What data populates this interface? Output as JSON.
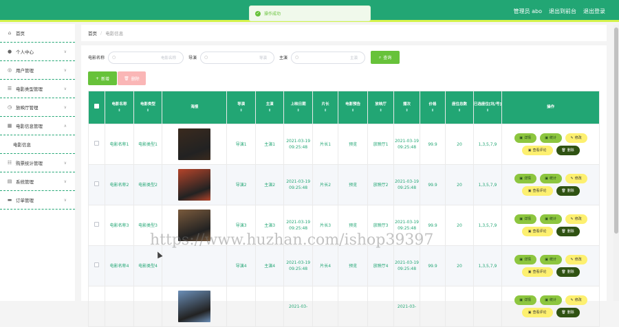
{
  "header": {
    "user": "管理员 abo",
    "back_label": "退出到前台",
    "logout_label": "退出登录"
  },
  "toast": {
    "message": "操作成功"
  },
  "sidebar": {
    "items": [
      {
        "label": "首页",
        "icon": "home-icon",
        "chev": ""
      },
      {
        "label": "个人中心",
        "icon": "user-icon",
        "chev": "∨"
      },
      {
        "label": "用户管理",
        "icon": "users-icon",
        "chev": "∨"
      },
      {
        "label": "电影类型管理",
        "icon": "list-icon",
        "chev": "∨"
      },
      {
        "label": "放映厅管理",
        "icon": "clock-icon",
        "chev": "∨"
      },
      {
        "label": "电影信息管理",
        "icon": "grid-icon",
        "chev": "∧"
      },
      {
        "label": "电影信息",
        "sub": true
      },
      {
        "label": "购票统计管理",
        "icon": "chart-icon",
        "chev": "∨"
      },
      {
        "label": "系统管理",
        "icon": "settings-icon",
        "chev": "∨"
      },
      {
        "label": "订单管理",
        "icon": "order-icon",
        "chev": "∨"
      }
    ]
  },
  "breadcrumb": {
    "home": "首页",
    "sep": "/",
    "current": "电影信息"
  },
  "search": {
    "label1": "电影名称",
    "ph1": "电影名称",
    "label2": "导演",
    "ph2": "导演",
    "label3": "主演",
    "ph3": "主演",
    "button": "查询"
  },
  "actions": {
    "add": "新增",
    "delete": "删除"
  },
  "table": {
    "headers": [
      "电影名称",
      "电影类型",
      "海报",
      "导演",
      "主演",
      "上映日期",
      "片长",
      "电影预告",
      "放映厅",
      "播次",
      "价格",
      "座位总数",
      "已选座位[坑/号]",
      "操作"
    ],
    "rows": [
      {
        "name": "电影名称1",
        "type": "电影类型1",
        "director": "导演1",
        "actor": "主演1",
        "date": "2021-03-19 09:25:48",
        "length": "片长1",
        "trailer": "预览",
        "hall": "放映厅1",
        "show": "2021-03-19 09:25:48",
        "price": "99.9",
        "seats": "20",
        "selected": "1,3,5,7,9",
        "poster": "#3a2a1e"
      },
      {
        "name": "电影名称2",
        "type": "电影类型2",
        "director": "导演2",
        "actor": "主演2",
        "date": "2021-03-19 09:25:48",
        "length": "片长2",
        "trailer": "预览",
        "hall": "放映厅2",
        "show": "2021-03-19 09:25:48",
        "price": "99.9",
        "seats": "20",
        "selected": "1,3,5,7,9",
        "poster": "#b5442a"
      },
      {
        "name": "电影名称3",
        "type": "电影类型3",
        "director": "导演3",
        "actor": "主演3",
        "date": "2021-03-19 09:25:48",
        "length": "片长3",
        "trailer": "预览",
        "hall": "放映厅3",
        "show": "2021-03-19 09:25:48",
        "price": "99.9",
        "seats": "20",
        "selected": "1,3,5,7,9",
        "poster": "#7a5a3c"
      },
      {
        "name": "电影名称4",
        "type": "电影类型4",
        "director": "导演4",
        "actor": "主演4",
        "date": "2021-03-19 09:25:48",
        "length": "片长4",
        "trailer": "预览",
        "hall": "放映厅4",
        "show": "2021-03-19 09:25:48",
        "price": "99.9",
        "seats": "20",
        "selected": "1,3,5,7,9",
        "poster": ""
      },
      {
        "name": "",
        "type": "",
        "director": "",
        "actor": "",
        "date": "2021-03-",
        "length": "",
        "trailer": "",
        "hall": "",
        "show": "2021-03-",
        "price": "",
        "seats": "",
        "selected": "",
        "poster": "#6b8fb8"
      }
    ],
    "ops": {
      "detail": "详情",
      "stats": "统计",
      "edit": "修改",
      "comments": "查看评论",
      "delete": "删除"
    }
  },
  "watermark": "https://www.huzhan.com/ishop39397",
  "colors": {
    "primary": "#22a674",
    "accent": "#d5f34b",
    "success": "#67c23a"
  }
}
